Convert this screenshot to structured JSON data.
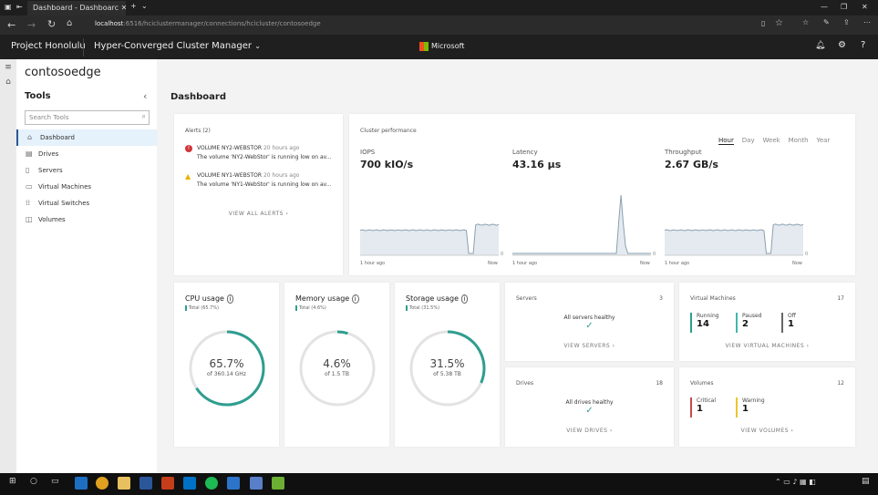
{
  "browser": {
    "tab_title": "Dashboard - Dashboarc",
    "url_host": "localhost",
    "url_path": ":6516/hciclustermanager/connections/hcicluster/contosoedge"
  },
  "app": {
    "product": "Project Honolulu",
    "solution": "Hyper-Converged Cluster Manager",
    "brand": "Microsoft"
  },
  "connection": "contosoedge",
  "sidebar": {
    "title": "Tools",
    "search_placeholder": "Search Tools",
    "items": [
      {
        "label": "Dashboard",
        "icon": "home-icon"
      },
      {
        "label": "Drives",
        "icon": "drive-icon"
      },
      {
        "label": "Servers",
        "icon": "server-icon"
      },
      {
        "label": "Virtual Machines",
        "icon": "vm-icon"
      },
      {
        "label": "Virtual Switches",
        "icon": "switch-icon"
      },
      {
        "label": "Volumes",
        "icon": "volume-icon"
      }
    ]
  },
  "page_title": "Dashboard",
  "alerts": {
    "title": "Alerts (2)",
    "items": [
      {
        "severity": "critical",
        "name": "VOLUME NY2-WEBSTOR",
        "time": "20 hours ago",
        "message": "The volume 'NY2-WebStor' is running low on av..."
      },
      {
        "severity": "warning",
        "name": "VOLUME NY1-WEBSTOR",
        "time": "20 hours ago",
        "message": "The volume 'NY1-WebStor' is running low on av..."
      }
    ],
    "view_all": "VIEW ALL ALERTS"
  },
  "performance": {
    "title": "Cluster performance",
    "ranges": [
      "Hour",
      "Day",
      "Week",
      "Month",
      "Year"
    ],
    "selected": "Hour",
    "metrics": [
      {
        "label": "IOPS",
        "value": "700 kIO/s"
      },
      {
        "label": "Latency",
        "value": "43.16 µs"
      },
      {
        "label": "Throughput",
        "value": "2.67 GB/s"
      }
    ],
    "x_start": "1 hour ago",
    "x_end": "Now",
    "y_zero": "0"
  },
  "usage": [
    {
      "title": "CPU usage",
      "legend": "Total (65.7%)",
      "percent": 65.7,
      "value": "65.7%",
      "of": "of 360.14 GHz"
    },
    {
      "title": "Memory usage",
      "legend": "Total (4.6%)",
      "percent": 4.6,
      "value": "4.6%",
      "of": "of 1.5 TB"
    },
    {
      "title": "Storage usage",
      "legend": "Total (31.5%)",
      "percent": 31.5,
      "value": "31.5%",
      "of": "of 5.38 TB"
    }
  ],
  "servers": {
    "title": "Servers",
    "count": "3",
    "status": "All servers healthy",
    "link": "VIEW SERVERS"
  },
  "drives": {
    "title": "Drives",
    "count": "18",
    "status": "All drives healthy",
    "link": "VIEW DRIVES"
  },
  "vms": {
    "title": "Virtual Machines",
    "count": "17",
    "stats": [
      {
        "label": "Running",
        "value": "14",
        "color": "#2e9e8f"
      },
      {
        "label": "Paused",
        "value": "2",
        "color": "#3fb8ad"
      },
      {
        "label": "Off",
        "value": "1",
        "color": "#666666"
      }
    ],
    "link": "VIEW VIRTUAL MACHINES"
  },
  "volumes": {
    "title": "Volumes",
    "count": "12",
    "stats": [
      {
        "label": "Critical",
        "value": "1",
        "color": "#c74b4b"
      },
      {
        "label": "Warning",
        "value": "1",
        "color": "#e8c62e"
      }
    ],
    "link": "VIEW VOLUMES"
  },
  "colors": {
    "accent": "#2e9e8f",
    "nav_selected": "#e5f1fb"
  }
}
